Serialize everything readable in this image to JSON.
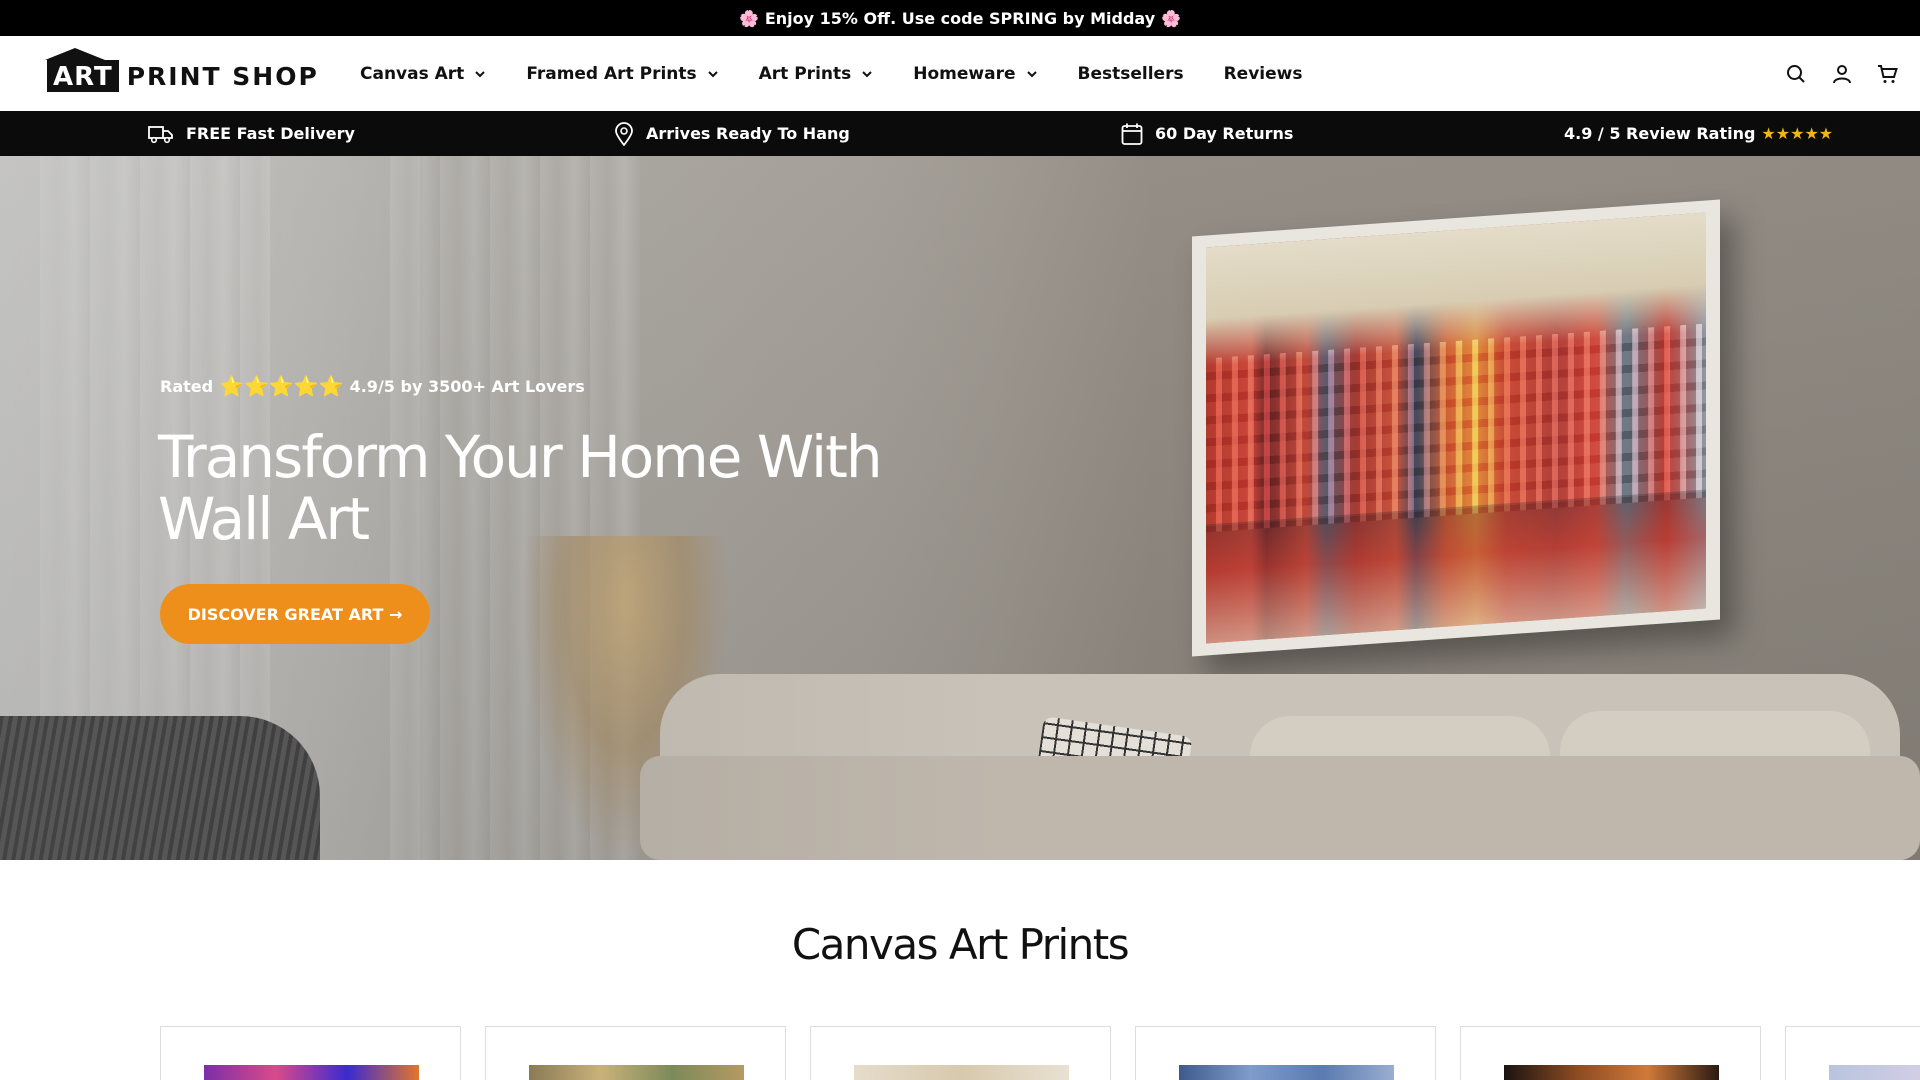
{
  "announcement": {
    "text": "Enjoy 15% Off. Use code SPRING by Midday",
    "flower_left": "🌸",
    "flower_right": "🌸"
  },
  "brand": {
    "logo_art": "ART",
    "logo_rest": "PRINT SHOP"
  },
  "nav": {
    "items": [
      {
        "label": "Canvas Art",
        "has_dropdown": true
      },
      {
        "label": "Framed Art Prints",
        "has_dropdown": true
      },
      {
        "label": "Art Prints",
        "has_dropdown": true
      },
      {
        "label": "Homeware",
        "has_dropdown": true
      },
      {
        "label": "Bestsellers",
        "has_dropdown": false
      },
      {
        "label": "Reviews",
        "has_dropdown": false
      }
    ]
  },
  "header_icons": [
    "search-icon",
    "account-icon",
    "cart-icon"
  ],
  "benefits": [
    {
      "icon": "truck-icon",
      "label": "FREE Fast Delivery"
    },
    {
      "icon": "pin-icon",
      "label": "Arrives Ready To Hang"
    },
    {
      "icon": "calendar-icon",
      "label": "60 Day Returns"
    },
    {
      "icon": "star-icon",
      "label": "4.9 / 5 Review Rating",
      "stars": "★★★★★"
    }
  ],
  "hero": {
    "rating_prefix": "Rated",
    "rating_stars": "⭐⭐⭐⭐⭐",
    "rating_suffix": "4.9/5 by 3500+ Art Lovers",
    "headline": "Transform Your Home With Wall Art",
    "cta_label": "DISCOVER GREAT ART →"
  },
  "section": {
    "title": "Canvas Art Prints"
  },
  "colors": {
    "accent": "#ee8f1c",
    "star": "#f5b21b",
    "bar": "#000000"
  }
}
